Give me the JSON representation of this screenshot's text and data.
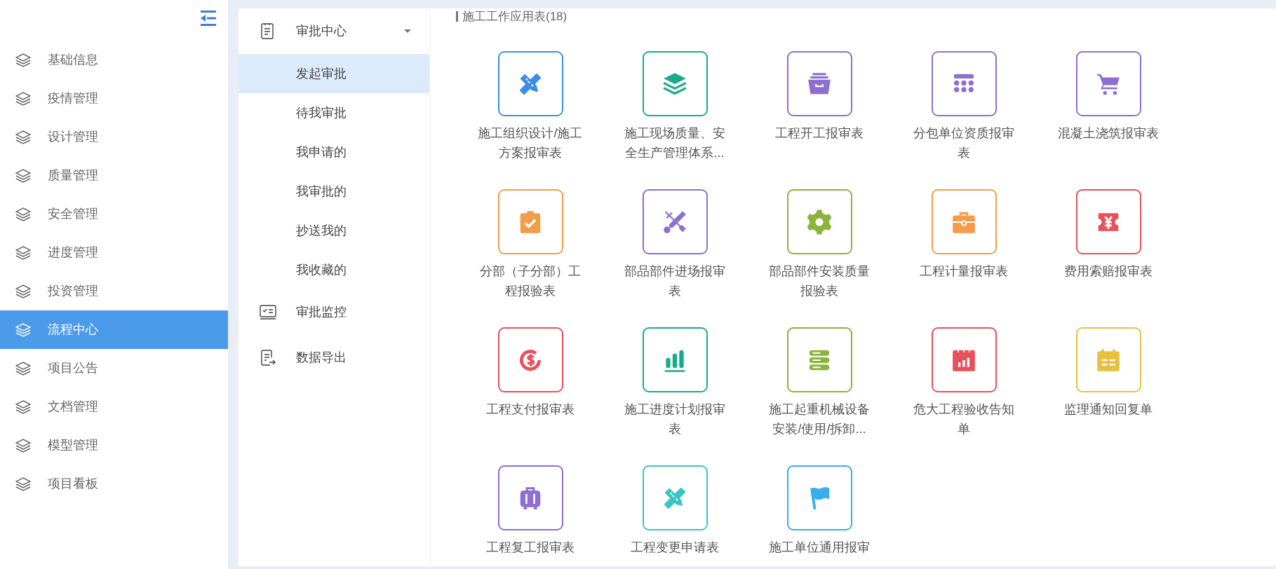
{
  "sidebar": {
    "items": [
      {
        "label": "基础信息",
        "selected": false
      },
      {
        "label": "疫情管理",
        "selected": false
      },
      {
        "label": "设计管理",
        "selected": false
      },
      {
        "label": "质量管理",
        "selected": false
      },
      {
        "label": "安全管理",
        "selected": false
      },
      {
        "label": "进度管理",
        "selected": false
      },
      {
        "label": "投资管理",
        "selected": false
      },
      {
        "label": "流程中心",
        "selected": true
      },
      {
        "label": "项目公告",
        "selected": false
      },
      {
        "label": "文档管理",
        "selected": false
      },
      {
        "label": "模型管理",
        "selected": false
      },
      {
        "label": "项目看板",
        "selected": false
      }
    ]
  },
  "submenu": {
    "groups": [
      {
        "label": "审批中心",
        "expanded": true,
        "children": [
          {
            "label": "发起审批",
            "selected": true
          },
          {
            "label": "待我审批",
            "selected": false
          },
          {
            "label": "我申请的",
            "selected": false
          },
          {
            "label": "我审批的",
            "selected": false
          },
          {
            "label": "抄送我的",
            "selected": false
          },
          {
            "label": "我收藏的",
            "selected": false
          }
        ]
      },
      {
        "label": "审批监控"
      },
      {
        "label": "数据导出"
      }
    ]
  },
  "main": {
    "section_title": "施工工作应用表(18)",
    "tiles": [
      {
        "label": "施工组织设计/施工方案报审表",
        "color": "#3a8ee6"
      },
      {
        "label": "施工现场质量、安全生产管理体系...",
        "color": "#19aa8d"
      },
      {
        "label": "工程开工报审表",
        "color": "#8e6fcf"
      },
      {
        "label": "分包单位资质报审表",
        "color": "#8e6fcf"
      },
      {
        "label": "混凝土浇筑报审表",
        "color": "#8e6fcf"
      },
      {
        "label": "分部（子分部）工程报验表",
        "color": "#f39c4a"
      },
      {
        "label": "部品部件进场报审表",
        "color": "#8e6fcf"
      },
      {
        "label": "部品部件安装质量报验表",
        "color": "#8ab43c"
      },
      {
        "label": "工程计量报审表",
        "color": "#f39c4a"
      },
      {
        "label": "费用索赔报审表",
        "color": "#e8505b"
      },
      {
        "label": "工程支付报审表",
        "color": "#e8505b"
      },
      {
        "label": "施工进度计划报审表",
        "color": "#19aa8d"
      },
      {
        "label": "施工起重机械设备安装/使用/拆卸...",
        "color": "#8ab43c"
      },
      {
        "label": "危大工程验收告知单",
        "color": "#e8505b"
      },
      {
        "label": "监理通知回复单",
        "color": "#e8c13f"
      },
      {
        "label": "工程复工报审表",
        "color": "#8e6fcf"
      },
      {
        "label": "工程变更申请表",
        "color": "#3cc4c4"
      },
      {
        "label": "施工单位通用报审",
        "color": "#3aaeea"
      }
    ]
  }
}
